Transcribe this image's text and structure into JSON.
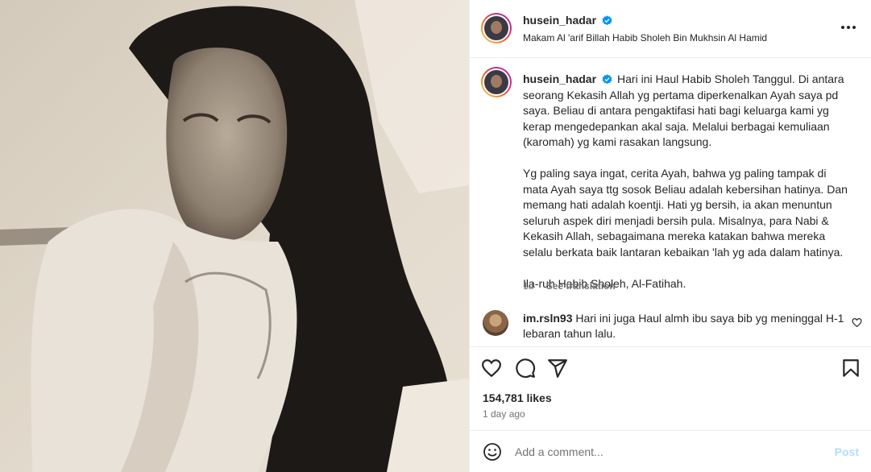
{
  "post": {
    "username": "husein_hadar",
    "location": "Makam Al 'arif Billah Habib Sholeh Bin Mukhsin Al Hamid",
    "photo_icon": "vintage-portrait-photo"
  },
  "caption": {
    "username": "husein_hadar",
    "paragraph_1": "Hari ini Haul Habib Sholeh Tanggul. Di antara seorang Kekasih Allah yg pertama diperkenalkan Ayah saya pd saya. Beliau di antara pengaktifasi hati bagi keluarga kami yg kerap mengedepankan akal saja. Melalui berbagai kemuliaan (karomah) yg kami rasakan langsung.",
    "paragraph_2": "Yg paling saya ingat, cerita Ayah, bahwa yg paling tampak di mata Ayah saya ttg sosok Beliau adalah kebersihan hatinya. Dan memang hati adalah koentji. Hati yg bersih, ia akan menuntun seluruh aspek diri menjadi bersih pula. Misalnya, para Nabi & Kekasih Allah, sebagaimana mereka katakan bahwa mereka selalu berkata baik lantaran kebaikan 'lah yg ada dalam hatinya.",
    "paragraph_3": "Ila-ruh Habib Sholeh, Al-Fatihah.",
    "age": "1d",
    "see_translation": "See translation"
  },
  "comment": {
    "username": "im.rsln93",
    "text": "Hari ini juga Haul almh ibu saya bib yg meninggal H-1 lebaran tahun lalu."
  },
  "stats": {
    "likes": "154,781 likes",
    "time_ago": "1 day ago"
  },
  "add_comment": {
    "placeholder": "Add a comment...",
    "post_label": "Post"
  },
  "colors": {
    "verified": "#0095f6",
    "post_disabled": "#b3dbff",
    "secondary_text": "#737373"
  },
  "icons": [
    "more-icon",
    "verified-icon",
    "heart-icon",
    "comment-icon",
    "share-icon",
    "save-icon",
    "emoji-icon"
  ]
}
